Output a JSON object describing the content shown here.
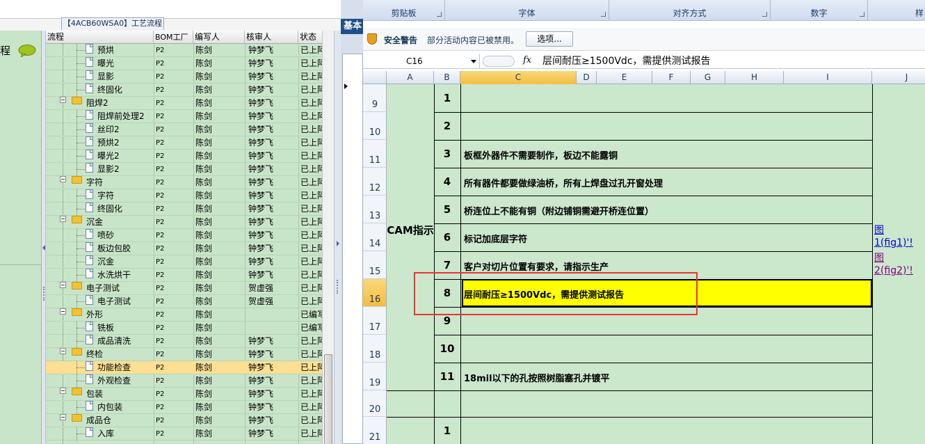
{
  "left_panel": {
    "tab_title": "【4ACB60WSA0】工艺流程",
    "side_label": "程",
    "columns": [
      "流程",
      "BOM工厂",
      "编写人",
      "核审人",
      "状态"
    ],
    "rows": [
      {
        "level": 2,
        "type": "doc",
        "name": "预烘",
        "bom": "P2",
        "editor": "陈剑",
        "reviewer": "钟梦飞",
        "status": "已上阿"
      },
      {
        "level": 2,
        "type": "doc",
        "name": "曝光",
        "bom": "P2",
        "editor": "陈剑",
        "reviewer": "钟梦飞",
        "status": "已上阿"
      },
      {
        "level": 2,
        "type": "doc",
        "name": "显影",
        "bom": "P2",
        "editor": "陈剑",
        "reviewer": "钟梦飞",
        "status": "已上阿"
      },
      {
        "level": 2,
        "type": "doc",
        "name": "终固化",
        "bom": "P2",
        "editor": "陈剑",
        "reviewer": "钟梦飞",
        "status": "已上阿"
      },
      {
        "level": 1,
        "type": "folder",
        "name": "阻焊2",
        "bom": "P2",
        "editor": "陈剑",
        "reviewer": "钟梦飞",
        "status": "已上阿"
      },
      {
        "level": 2,
        "type": "doc",
        "name": "阻焊前处理2",
        "bom": "P2",
        "editor": "陈剑",
        "reviewer": "钟梦飞",
        "status": "已上阿"
      },
      {
        "level": 2,
        "type": "doc",
        "name": "丝印2",
        "bom": "P2",
        "editor": "陈剑",
        "reviewer": "钟梦飞",
        "status": "已上阿"
      },
      {
        "level": 2,
        "type": "doc",
        "name": "预烘2",
        "bom": "P2",
        "editor": "陈剑",
        "reviewer": "钟梦飞",
        "status": "已上阿"
      },
      {
        "level": 2,
        "type": "doc",
        "name": "曝光2",
        "bom": "P2",
        "editor": "陈剑",
        "reviewer": "钟梦飞",
        "status": "已上阿"
      },
      {
        "level": 2,
        "type": "doc",
        "name": "显影2",
        "bom": "P2",
        "editor": "陈剑",
        "reviewer": "钟梦飞",
        "status": "已上阿"
      },
      {
        "level": 1,
        "type": "folder",
        "name": "字符",
        "bom": "P2",
        "editor": "陈剑",
        "reviewer": "钟梦飞",
        "status": "已上阿"
      },
      {
        "level": 2,
        "type": "doc",
        "name": "字符",
        "bom": "P2",
        "editor": "陈剑",
        "reviewer": "钟梦飞",
        "status": "已上阿"
      },
      {
        "level": 2,
        "type": "doc",
        "name": "终固化",
        "bom": "P2",
        "editor": "陈剑",
        "reviewer": "钟梦飞",
        "status": "已上阿"
      },
      {
        "level": 1,
        "type": "folder",
        "name": "沉金",
        "bom": "P2",
        "editor": "陈剑",
        "reviewer": "钟梦飞",
        "status": "已上阿"
      },
      {
        "level": 2,
        "type": "doc",
        "name": "喷砂",
        "bom": "P2",
        "editor": "陈剑",
        "reviewer": "钟梦飞",
        "status": "已上阿"
      },
      {
        "level": 2,
        "type": "doc",
        "name": "板边包胶",
        "bom": "P2",
        "editor": "陈剑",
        "reviewer": "钟梦飞",
        "status": "已上阿"
      },
      {
        "level": 2,
        "type": "doc",
        "name": "沉金",
        "bom": "P2",
        "editor": "陈剑",
        "reviewer": "钟梦飞",
        "status": "已上阿"
      },
      {
        "level": 2,
        "type": "doc",
        "name": "水洗烘干",
        "bom": "P2",
        "editor": "陈剑",
        "reviewer": "钟梦飞",
        "status": "已上阿"
      },
      {
        "level": 1,
        "type": "folder",
        "name": "电子测试",
        "bom": "P2",
        "editor": "陈剑",
        "reviewer": "贺虚强",
        "status": "已上阿"
      },
      {
        "level": 2,
        "type": "doc",
        "name": "电子测试",
        "bom": "P2",
        "editor": "陈剑",
        "reviewer": "贺虚强",
        "status": "已上阿"
      },
      {
        "level": 1,
        "type": "folder",
        "name": "外形",
        "bom": "P2",
        "editor": "陈剑",
        "reviewer": "",
        "status": "已编写"
      },
      {
        "level": 2,
        "type": "doc",
        "name": "铣板",
        "bom": "P2",
        "editor": "陈剑",
        "reviewer": "",
        "status": "已编写"
      },
      {
        "level": 2,
        "type": "doc",
        "name": "成品清洗",
        "bom": "P2",
        "editor": "陈剑",
        "reviewer": "钟梦飞",
        "status": "已上阿"
      },
      {
        "level": 1,
        "type": "folder",
        "name": "终检",
        "bom": "P2",
        "editor": "陈剑",
        "reviewer": "钟梦飞",
        "status": "已上阿"
      },
      {
        "level": 2,
        "type": "doc",
        "name": "功能检查",
        "bom": "P2",
        "editor": "陈剑",
        "reviewer": "钟梦飞",
        "status": "已上阿",
        "selected": true
      },
      {
        "level": 2,
        "type": "doc",
        "name": "外观检查",
        "bom": "P2",
        "editor": "陈剑",
        "reviewer": "钟梦飞",
        "status": "已上阿"
      },
      {
        "level": 1,
        "type": "folder",
        "name": "包装",
        "bom": "P2",
        "editor": "陈剑",
        "reviewer": "钟梦飞",
        "status": "已上阿"
      },
      {
        "level": 2,
        "type": "doc",
        "name": "内包装",
        "bom": "P2",
        "editor": "陈剑",
        "reviewer": "钟梦飞",
        "status": "已上阿"
      },
      {
        "level": 1,
        "type": "folder",
        "name": "成品仓",
        "bom": "P2",
        "editor": "陈剑",
        "reviewer": "钟梦飞",
        "status": "已上阿"
      },
      {
        "level": 2,
        "type": "doc",
        "name": "入库",
        "bom": "P2",
        "editor": "陈剑",
        "reviewer": "钟梦飞",
        "status": "已上阿"
      }
    ]
  },
  "middle": {
    "tab_label": "基本"
  },
  "excel": {
    "ribbon_groups": [
      "剪贴板",
      "字体",
      "对齐方式",
      "数字",
      "样"
    ],
    "security": {
      "title": "安全警告",
      "message": "部分活动内容已被禁用。",
      "button": "选项..."
    },
    "name_box": "C16",
    "fx_label": "fx",
    "formula": "层间耐压≥1500Vdc，需提供测试报告",
    "columns": [
      "A",
      "B",
      "C",
      "D",
      "E",
      "F",
      "G",
      "H",
      "I",
      "J"
    ],
    "active_column": "C",
    "active_row": "16",
    "section_label": "CAM指示",
    "rows": [
      {
        "row": "9",
        "num": "1",
        "text": ""
      },
      {
        "row": "10",
        "num": "2",
        "text": ""
      },
      {
        "row": "11",
        "num": "3",
        "text": "板框外器件不需要制作，板边不能露铜"
      },
      {
        "row": "12",
        "num": "4",
        "text": "所有器件都要做绿油桥，所有上焊盘过孔开窗处理"
      },
      {
        "row": "13",
        "num": "5",
        "text": "桥连位上不能有铜（附边铺铜需避开桥连位置）"
      },
      {
        "row": "14",
        "num": "6",
        "text": "标记加底层字符"
      },
      {
        "row": "15",
        "num": "7",
        "text": "客户对切片位置有要求，请指示生产"
      },
      {
        "row": "16",
        "num": "8",
        "text": "层间耐压≥1500Vdc，需提供测试报告"
      },
      {
        "row": "17",
        "num": "9",
        "text": ""
      },
      {
        "row": "18",
        "num": "10",
        "text": ""
      },
      {
        "row": "19",
        "num": "11",
        "text": "18mil以下的孔按照树脂塞孔并镀平"
      },
      {
        "row": "20",
        "num": "",
        "text": ""
      },
      {
        "row": "21",
        "num": "1",
        "text": ""
      }
    ],
    "links": [
      {
        "line1": "图",
        "line2": "1(fig1)'!"
      },
      {
        "line1": "图",
        "line2": "2(fig2)'!"
      }
    ],
    "colors": {
      "highlight": "#ffff00",
      "annotation_box": "#e33333",
      "sheet_bg": "#cbe7cc",
      "link_1": "#0000cc",
      "link_2": "#800080"
    }
  }
}
